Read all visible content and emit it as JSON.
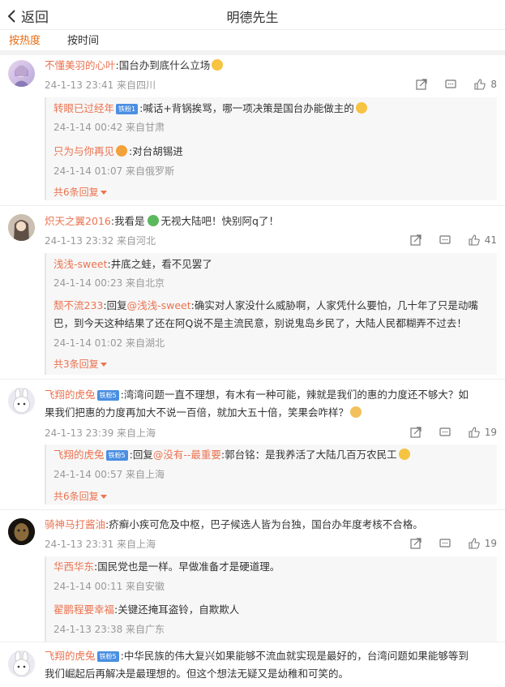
{
  "header": {
    "back_label": "返回",
    "title": "明德先生"
  },
  "sort": {
    "hot": "按热度",
    "time": "按时间"
  },
  "comments": [
    {
      "user": "不懂美羽的心叶",
      "text": ":国台办到底什么立场",
      "meta": "24-1-13 23:41 来自四川",
      "likes": "8",
      "replies": [
        {
          "user": "转眼已过经年",
          "badge": "铁粉1",
          "text": ":喊话+背锅挨骂，哪一项决策是国台办能做主的",
          "meta": "24-1-14 00:42 来自甘肃"
        },
        {
          "user": "只为与你再见",
          "text": ":对台胡锡进",
          "meta": "24-1-14 01:07 来自俄罗斯"
        }
      ],
      "more": "共6条回复"
    },
    {
      "user": "炽天之翼2016",
      "text": ":我看是",
      "text2": "无视大陆吧！快别阿q了！",
      "meta": "24-1-13 23:32 来自河北",
      "likes": "41",
      "replies": [
        {
          "user": "浅浅-sweet",
          "text": ":井底之蛙，看不见罢了",
          "meta": "24-1-14 00:23 来自北京"
        },
        {
          "user": "颓不流233",
          "text_pre": ":回复",
          "mention": "@浅浅-sweet",
          "text": ":确实对人家没什么威胁啊，人家凭什么要怕，几十年了只是动嘴",
          "text_cont": "巴，到今天这种结果了还在阿Q说不是主流民意，别说鬼岛乡民了，大陆人民都糊弄不过去！",
          "meta": "24-1-14 01:02 来自湖北"
        }
      ],
      "more": "共3条回复"
    },
    {
      "user": "飞翔的虎兔",
      "badge": "铁粉5",
      "text": ":湾湾问题一直不理想，有木有一种可能，辣就是我们的惠的力度还不够大？如",
      "text_cont": "果我们把惠的力度再加大不说一百倍，就加大五十倍，笑果会咋样？",
      "meta": "24-1-13 23:39 来自上海",
      "likes": "19",
      "replies": [
        {
          "user": "飞翔的虎兔",
          "badge": "铁粉5",
          "text_pre": ":回复",
          "mention": "@没有--最重要",
          "text": ":郭台铭：是我养活了大陆几百万农民工",
          "meta": "24-1-14 00:57 来自上海"
        }
      ],
      "more": "共6条回复"
    },
    {
      "user": "骑神马打酱油",
      "text": ":疥癣小疾可危及中枢，巴子候选人皆为台独，国台办年度考核不合格。",
      "meta": "24-1-13 23:31 来自上海",
      "likes": "19",
      "replies": [
        {
          "user": "华西华东",
          "text": ":国民党也是一样。早做准备才是硬道理。",
          "meta": "24-1-14 00:11 来自安徽"
        },
        {
          "user": "翟鹏程要幸福",
          "text": ":关键还掩耳盗铃，自欺欺人",
          "meta": "24-1-13 23:38 来自广东"
        }
      ]
    },
    {
      "user": "飞翔的虎兔",
      "badge": "铁粉5",
      "text": ":中华民族的伟大复兴如果能够不流血就实现是最好的，台湾问题如果能够等到",
      "text_cont": "我们崛起后再解决是最理想的。但这个想法无疑又是幼稚和可笑的。"
    }
  ],
  "colors": {
    "accent": "#eb7350",
    "tab_active": "#e86b0f",
    "badge": "#4a8fe2"
  },
  "icons": [
    "back-chevron-icon",
    "share-icon",
    "comment-icon",
    "like-icon",
    "frog-emoji-icon",
    "laugh-emoji-icon",
    "smile-emoji-icon",
    "cat-emoji-icon"
  ]
}
